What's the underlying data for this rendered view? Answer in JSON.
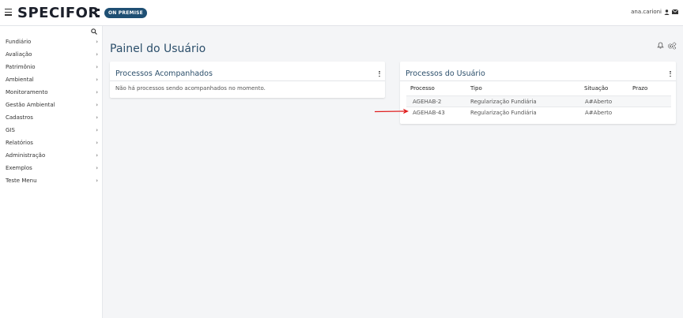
{
  "header": {
    "logo_text": "SPECIFOR",
    "badge": "ON PREMISE",
    "username": "ana.carioni",
    "icons": [
      "menu-icon",
      "user-icon",
      "mail-icon"
    ]
  },
  "sidebar": {
    "search_icon": "search-icon",
    "items": [
      {
        "label": "Fundiário"
      },
      {
        "label": "Avaliação"
      },
      {
        "label": "Patrimônio"
      },
      {
        "label": "Ambiental"
      },
      {
        "label": "Monitoramento"
      },
      {
        "label": "Gestão Ambiental"
      },
      {
        "label": "Cadastros"
      },
      {
        "label": "GIS"
      },
      {
        "label": "Relatórios"
      },
      {
        "label": "Administração"
      },
      {
        "label": "Exemplos"
      },
      {
        "label": "Teste Menu"
      }
    ],
    "chevron": "›"
  },
  "main": {
    "title": "Painel do Usuário",
    "tracked": {
      "title": "Processos Acompanhados",
      "empty_message": "Não há processos sendo acompanhados no momento."
    },
    "user_processes": {
      "title": "Processos do Usuário",
      "columns": [
        "Processo",
        "Tipo",
        "Situação",
        "Prazo"
      ],
      "rows": [
        {
          "processo": "AGEHAB-2",
          "tipo": "Regularização Fundiária",
          "situacao": "A#Aberto",
          "prazo": ""
        },
        {
          "processo": "AGEHAB-43",
          "tipo": "Regularização Fundiária",
          "situacao": "A#Aberto",
          "prazo": ""
        }
      ]
    }
  },
  "colors": {
    "badge_bg": "#1e4f73",
    "title_color": "#2c4f6b",
    "arrow": "#e02020"
  }
}
